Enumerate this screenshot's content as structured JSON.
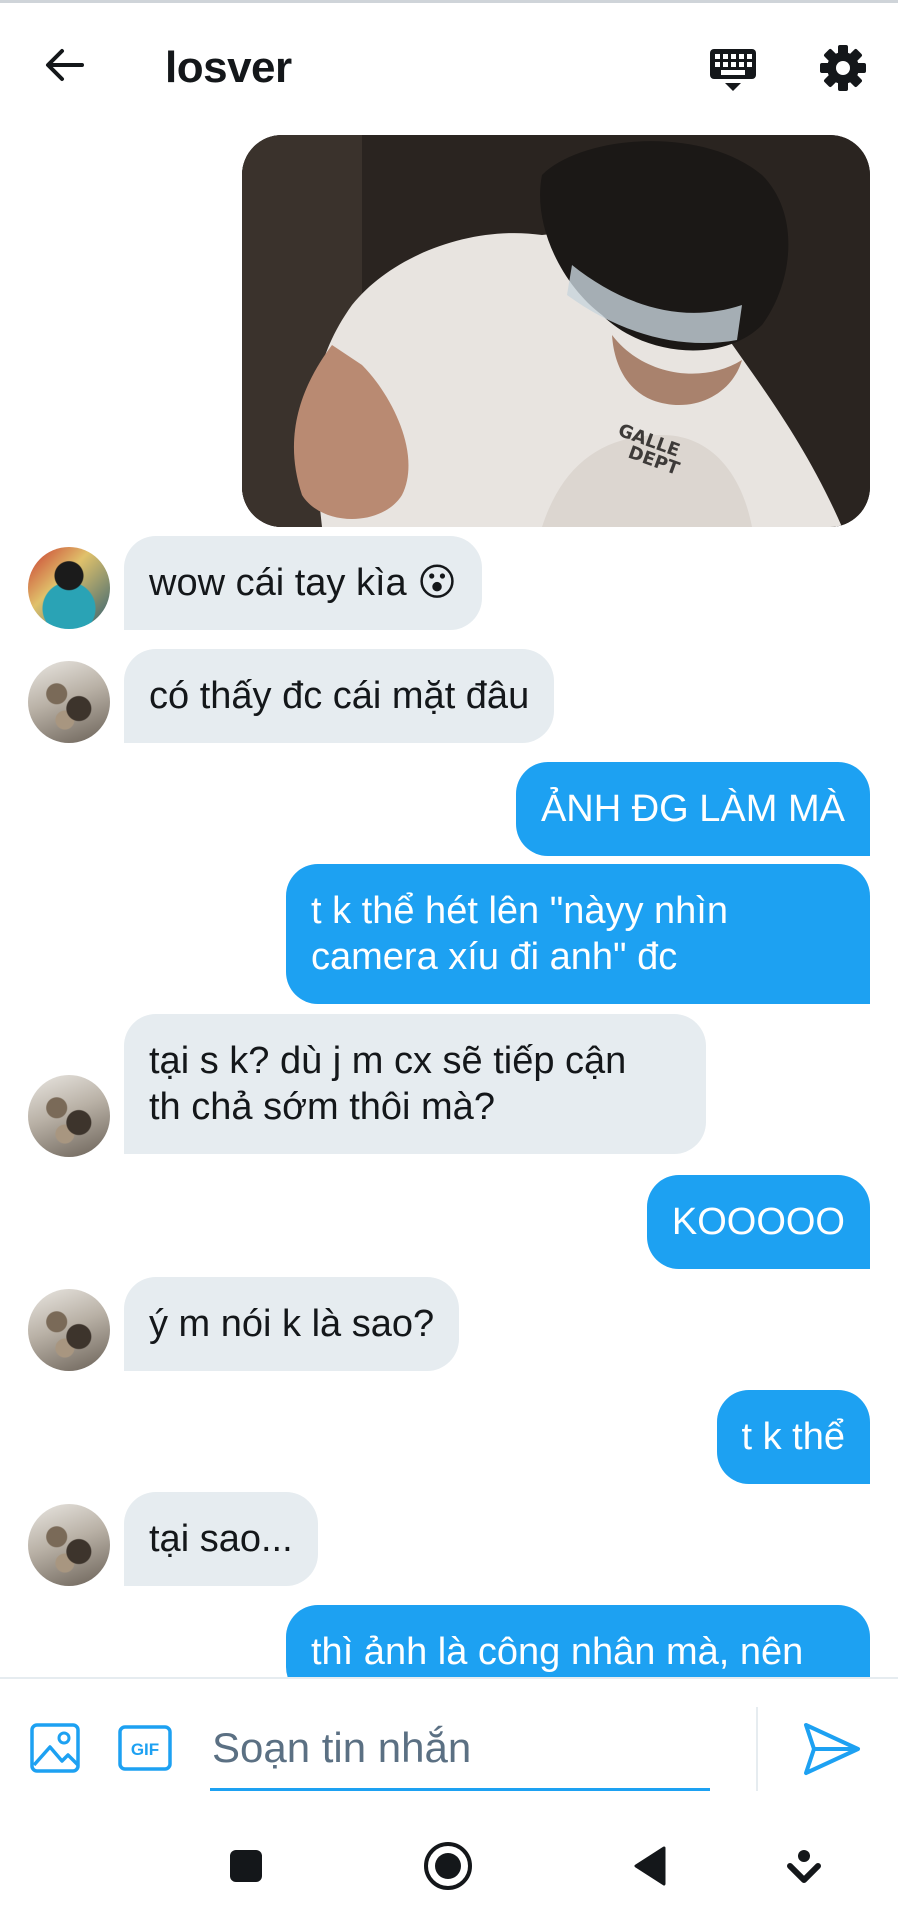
{
  "header": {
    "title": "losver",
    "back_icon": "arrow-left-icon",
    "keyboard_icon": "keyboard-icon",
    "settings_icon": "gear-icon"
  },
  "messages": [
    {
      "type": "image",
      "direction": "sent",
      "icon": "photo-image"
    },
    {
      "direction": "received",
      "lines": [
        "wow cái tay kìa 😮"
      ]
    },
    {
      "direction": "received",
      "lines": [
        "có thấy đc cái mặt đâu"
      ]
    },
    {
      "direction": "sent",
      "lines": [
        "ẢNH ĐG LÀM MÀ"
      ]
    },
    {
      "direction": "sent",
      "lines": [
        "t k thể hét lên \"nàyy nhìn",
        "camera xíu đi anh\" đc"
      ]
    },
    {
      "direction": "received",
      "lines": [
        "tại s k? dù j m cx sẽ tiếp cận",
        "th chả sớm thôi mà?"
      ]
    },
    {
      "direction": "sent",
      "lines": [
        "KOOOOO"
      ]
    },
    {
      "direction": "received",
      "lines": [
        "ý m nói k là sao?"
      ]
    },
    {
      "direction": "sent",
      "lines": [
        "t k thể"
      ]
    },
    {
      "direction": "received",
      "lines": [
        "tại sao..."
      ]
    },
    {
      "direction": "sent",
      "lines": [
        "thì ảnh là công nhân mà, nên"
      ]
    }
  ],
  "composer": {
    "placeholder": "Soạn tin nhắn",
    "value": "",
    "image_icon": "image-icon",
    "gif_label": "GIF",
    "send_icon": "send-icon"
  },
  "navbar": {
    "icons": [
      "square-icon",
      "circle-home-icon",
      "back-triangle-icon",
      "hide-keyboard-icon"
    ]
  },
  "colors": {
    "accent": "#1da1f2",
    "received_bubble": "#e6ecf0",
    "text": "#14171a",
    "placeholder": "#5b7083"
  }
}
